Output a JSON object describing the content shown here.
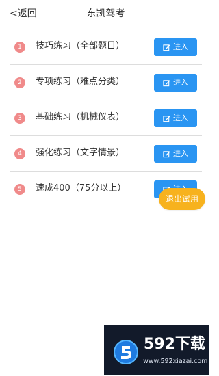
{
  "header": {
    "back_label": "<返回",
    "title": "东凯驾考"
  },
  "list": {
    "items": [
      {
        "number": "1",
        "label": "技巧练习（全部题目）",
        "button_label": "进入"
      },
      {
        "number": "2",
        "label": "专项练习（难点分类）",
        "button_label": "进入"
      },
      {
        "number": "3",
        "label": "基础练习（机械仪表）",
        "button_label": "进入"
      },
      {
        "number": "4",
        "label": "强化练习（文字情景）",
        "button_label": "进入"
      },
      {
        "number": "5",
        "label": "速成400（75分以上）",
        "button_label": "进入"
      }
    ]
  },
  "floating": {
    "exit_trial_label": "退出试用"
  },
  "watermark": {
    "brand": "592下载",
    "url": "www.592xiazai.com"
  },
  "colors": {
    "accent_blue": "#2a95f2",
    "badge_red": "#f08a8a",
    "orange": "#f7b21e",
    "divider": "#dddddd"
  },
  "icons": {
    "enter_button_icon": "edit-icon",
    "watermark_logo": "592-logo-icon"
  }
}
